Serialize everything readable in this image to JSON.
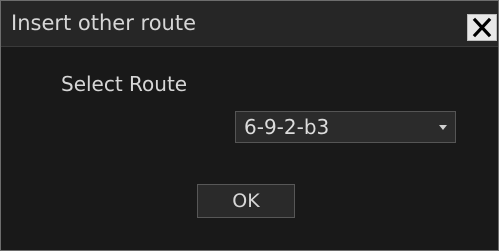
{
  "dialog": {
    "title": "Insert other route",
    "close_icon": "close-icon"
  },
  "route": {
    "label": "Select Route",
    "selected": "6-9-2-b3",
    "dropdown_icon": "chevron-down-icon"
  },
  "actions": {
    "ok_label": "OK"
  },
  "colors": {
    "background": "#1a1a1a",
    "titlebar": "#262626",
    "text": "#d6d6d6",
    "close_button": "#e8e8e8"
  }
}
